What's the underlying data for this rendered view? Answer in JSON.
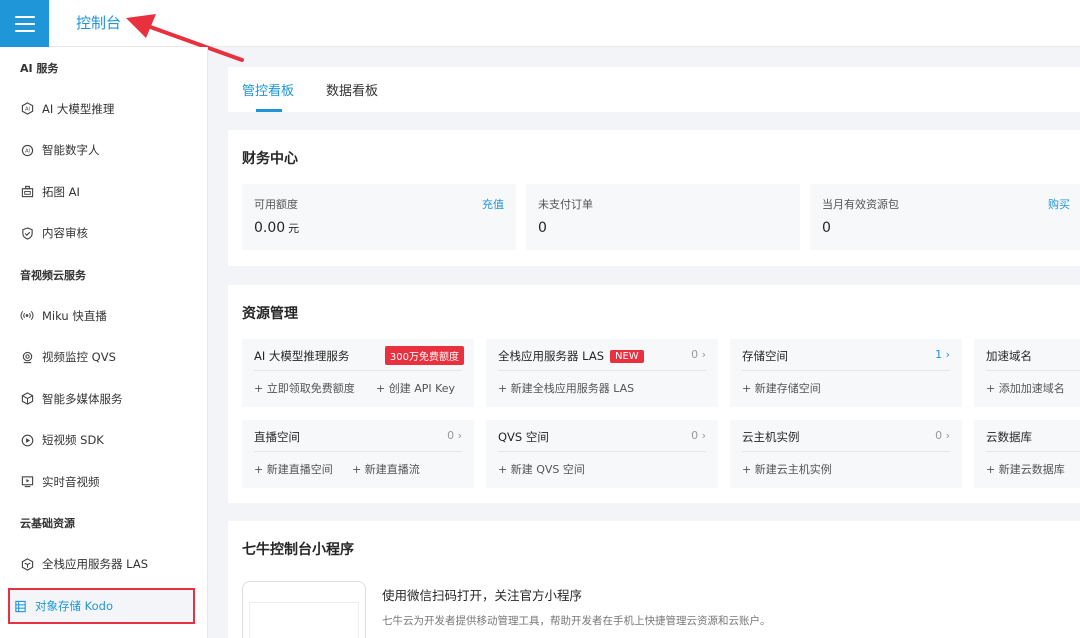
{
  "header": {
    "menu_icon": "hamburger-icon",
    "title": "控制台",
    "accent": "#1e96d8",
    "annotation_color": "#e8303f"
  },
  "sidebar": {
    "sections": [
      {
        "title": "AI 服务",
        "items": [
          {
            "label": "AI 大模型推理",
            "icon": "ai-chip-icon"
          },
          {
            "label": "智能数字人",
            "icon": "digital-human-icon"
          },
          {
            "label": "拓图 AI",
            "icon": "image-ai-icon"
          },
          {
            "label": "内容审核",
            "icon": "shield-check-icon"
          }
        ]
      },
      {
        "title": "音视频云服务",
        "items": [
          {
            "label": "Miku 快直播",
            "icon": "broadcast-icon"
          },
          {
            "label": "视频监控 QVS",
            "icon": "camera-icon"
          },
          {
            "label": "智能多媒体服务",
            "icon": "cube-icon"
          },
          {
            "label": "短视频 SDK",
            "icon": "play-circle-icon"
          },
          {
            "label": "实时音视频",
            "icon": "video-screen-icon"
          }
        ]
      },
      {
        "title": "云基础资源",
        "items": [
          {
            "label": "全栈应用服务器 LAS",
            "icon": "server-cube-icon"
          },
          {
            "label": "对象存储 Kodo",
            "icon": "storage-icon"
          }
        ]
      }
    ]
  },
  "tabs": [
    {
      "label": "管控看板"
    },
    {
      "label": "数据看板"
    }
  ],
  "finance": {
    "title": "财务中心",
    "boxes": [
      {
        "label": "可用额度",
        "link": "充值",
        "value": "0.00",
        "unit": "元"
      },
      {
        "label": "未支付订单",
        "link": "",
        "value": "0",
        "unit": ""
      },
      {
        "label": "当月有效资源包",
        "link": "购买",
        "value": "0",
        "unit": ""
      }
    ]
  },
  "resources": {
    "title": "资源管理",
    "row1": [
      {
        "name": "AI 大模型推理服务",
        "badge": "300万免费额度",
        "count": "",
        "actions": [
          "+ 立即领取免费额度",
          "+ 创建 API Key"
        ]
      },
      {
        "name": "全栈应用服务器 LAS",
        "badge": "NEW",
        "count": "0",
        "actions": [
          "+ 新建全栈应用服务器 LAS"
        ]
      },
      {
        "name": "存储空间",
        "badge": "",
        "count": "1",
        "actions": [
          "+ 新建存储空间"
        ]
      },
      {
        "name": "加速域名",
        "badge": "",
        "count": "",
        "actions": [
          "+ 添加加速域名"
        ]
      }
    ],
    "row2": [
      {
        "name": "直播空间",
        "count": "0",
        "actions": [
          "+ 新建直播空间",
          "+ 新建直播流"
        ]
      },
      {
        "name": "QVS 空间",
        "count": "0",
        "actions": [
          "+ 新建 QVS 空间"
        ]
      },
      {
        "name": "云主机实例",
        "count": "0",
        "actions": [
          "+ 新建云主机实例"
        ]
      },
      {
        "name": "云数据库",
        "count": "",
        "actions": [
          "+ 新建云数据库"
        ]
      }
    ]
  },
  "miniprogram": {
    "title": "七牛控制台小程序",
    "headline": "使用微信扫码打开，关注官方小程序",
    "desc": "七牛云为开发者提供移动管理工具，帮助开发者在手机上快捷管理云资源和云账户。"
  }
}
